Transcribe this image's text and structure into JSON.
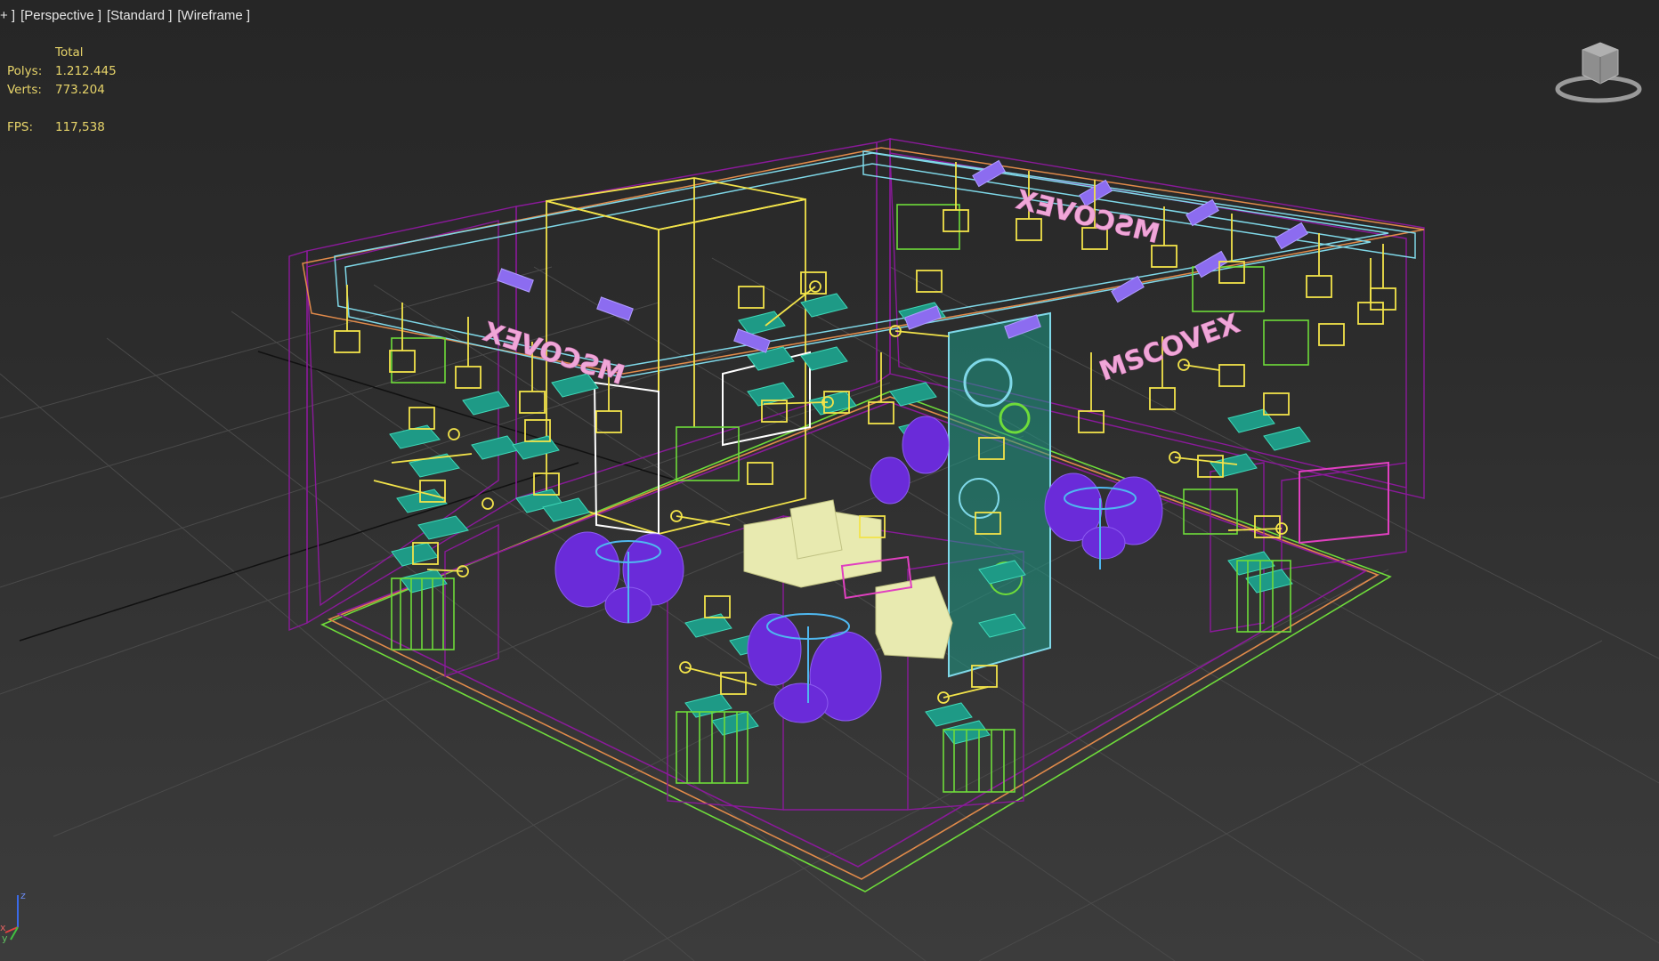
{
  "viewport": {
    "labels": [
      "+ ]",
      "[Perspective ]",
      "[Standard ]",
      "[Wireframe ]"
    ]
  },
  "stats": {
    "header": "Total",
    "polys_label": "Polys:",
    "polys_value": "1.212.445",
    "verts_label": "Verts:",
    "verts_value": "773.204",
    "fps_label": "FPS:",
    "fps_value": "117,538"
  },
  "scene": {
    "signs": [
      "MSCOVEX",
      "MSCOVEX",
      "MSCOVEX"
    ]
  },
  "axis": {
    "z": "z",
    "x": "x",
    "y": "y"
  },
  "colors": {
    "background_top": "#262626",
    "background_bottom": "#3c3c3c",
    "stats_text": "#e8d56a",
    "wire_magenta": "#8a1a9a",
    "wire_yellow": "#f2e34a",
    "wire_cyan": "#7fd8e8",
    "wire_green": "#6edc3a",
    "wire_orange": "#e08a4a",
    "object_purple": "#6a2bd9",
    "object_teal": "#1e9a86",
    "object_cream": "#e8eab0",
    "sign_pink": "#f0a6d8"
  },
  "icons": {
    "viewcube": "viewcube-icon",
    "axis": "axis-tripod-icon"
  }
}
